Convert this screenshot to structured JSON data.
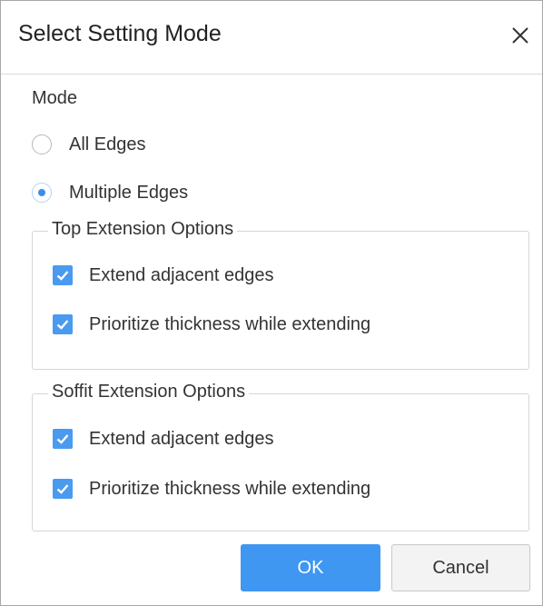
{
  "dialog": {
    "title": "Select Setting Mode",
    "close_icon": "close-icon"
  },
  "mode": {
    "label": "Mode",
    "options": [
      {
        "label": "All Edges",
        "selected": false
      },
      {
        "label": "Multiple Edges",
        "selected": true
      }
    ]
  },
  "top_extension": {
    "legend": "Top Extension Options",
    "options": [
      {
        "label": "Extend adjacent edges",
        "checked": true
      },
      {
        "label": "Prioritize thickness while extending",
        "checked": true
      }
    ]
  },
  "soffit_extension": {
    "legend": "Soffit Extension Options",
    "options": [
      {
        "label": "Extend adjacent edges",
        "checked": true
      },
      {
        "label": "Prioritize thickness while extending",
        "checked": true
      }
    ]
  },
  "buttons": {
    "ok": "OK",
    "cancel": "Cancel"
  },
  "colors": {
    "accent": "#3f97f2",
    "checkbox": "#4a9af0",
    "border": "#d6d6d6"
  }
}
